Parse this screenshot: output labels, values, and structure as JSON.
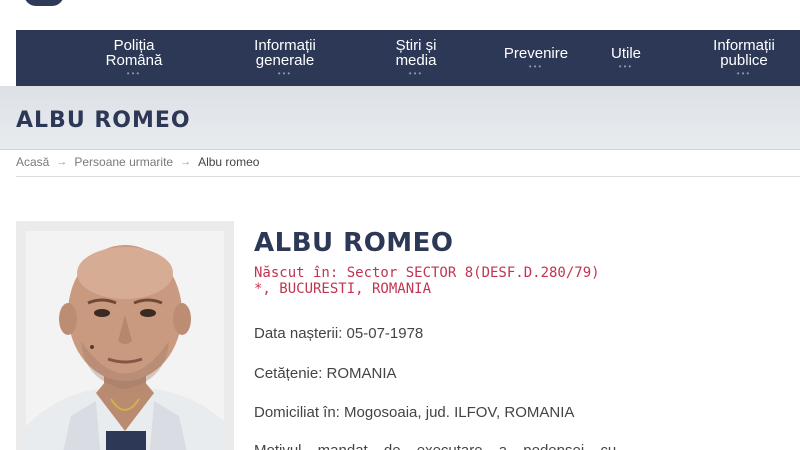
{
  "nav": {
    "items": [
      {
        "label_1": "Poliția",
        "label_2": "Română",
        "dots": "•••"
      },
      {
        "label_1": "Informații",
        "label_2": "generale",
        "dots": "•••"
      },
      {
        "label_1": "Știri și",
        "label_2": "media",
        "dots": "•••"
      },
      {
        "label_1": "Prevenire",
        "label_2": "",
        "dots": "•••"
      },
      {
        "label_1": "Utile",
        "label_2": "",
        "dots": "•••"
      },
      {
        "label_1": "Informații",
        "label_2": "publice",
        "dots": "•••"
      }
    ]
  },
  "page": {
    "title": "ALBU ROMEO"
  },
  "breadcrumb": {
    "home": "Acasă",
    "section": "Persoane urmarite",
    "current": "Albu romeo",
    "separator": "→"
  },
  "person": {
    "name": "ALBU ROMEO",
    "birth_place": "Născut în: Sector SECTOR 8(DESF.D.280/79) *, BUCURESTI, ROMANIA",
    "birth_date": "Data nașterii: 05-07-1978",
    "citizenship": "Cetățenie: ROMANIA",
    "residence": "Domiciliat în: Mogosoaia, jud. ILFOV, ROMANIA",
    "reason_partial": "Motivul mandat de executare a pedepsei cu"
  },
  "colors": {
    "navbar": "#2c3856",
    "title_band": "#e3e6ea",
    "accent_red": "#c2344f"
  }
}
